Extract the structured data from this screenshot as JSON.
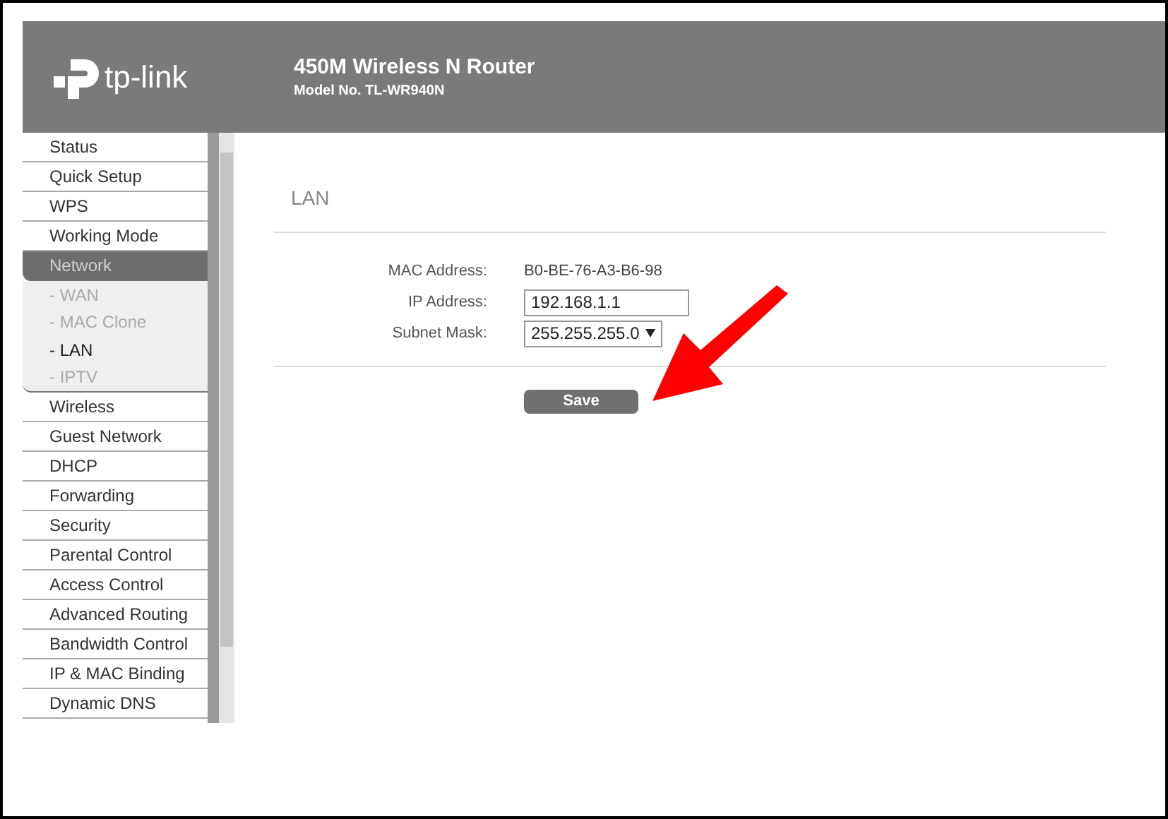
{
  "header": {
    "brand": "tp-link",
    "title": "450M Wireless N Router",
    "model": "Model No. TL-WR940N"
  },
  "sidebar": {
    "items": [
      {
        "label": "Status",
        "selected": false
      },
      {
        "label": "Quick Setup",
        "selected": false
      },
      {
        "label": "WPS",
        "selected": false
      },
      {
        "label": "Working Mode",
        "selected": false
      },
      {
        "label": "Network",
        "selected": true,
        "expanded": true,
        "children": [
          {
            "label": "- WAN",
            "selected": false
          },
          {
            "label": "- MAC Clone",
            "selected": false
          },
          {
            "label": "- LAN",
            "selected": true
          },
          {
            "label": "- IPTV",
            "selected": false
          }
        ]
      },
      {
        "label": "Wireless",
        "selected": false
      },
      {
        "label": "Guest Network",
        "selected": false
      },
      {
        "label": "DHCP",
        "selected": false
      },
      {
        "label": "Forwarding",
        "selected": false
      },
      {
        "label": "Security",
        "selected": false
      },
      {
        "label": "Parental Control",
        "selected": false
      },
      {
        "label": "Access Control",
        "selected": false
      },
      {
        "label": "Advanced Routing",
        "selected": false
      },
      {
        "label": "Bandwidth Control",
        "selected": false
      },
      {
        "label": "IP & MAC Binding",
        "selected": false
      },
      {
        "label": "Dynamic DNS",
        "selected": false
      }
    ]
  },
  "content": {
    "title": "LAN",
    "fields": [
      {
        "kind": "text",
        "label": "MAC Address:",
        "value": "B0-BE-76-A3-B6-98"
      },
      {
        "kind": "input",
        "label": "IP Address:",
        "value": "192.168.1.1"
      },
      {
        "kind": "select",
        "label": "Subnet Mask:",
        "value": "255.255.255.0"
      }
    ],
    "save_button": "Save"
  }
}
